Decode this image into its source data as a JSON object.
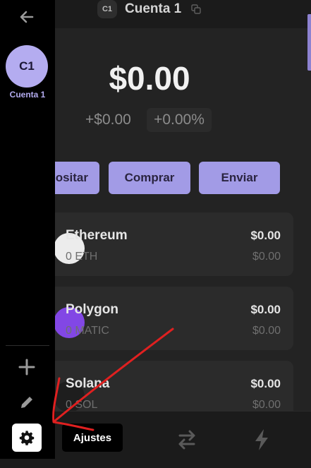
{
  "header": {
    "account_chip": "C1",
    "account_name": "Cuenta 1"
  },
  "balance": {
    "total": "$0.00",
    "change_usd": "+$0.00",
    "change_pct": "+0.00%"
  },
  "actions": {
    "deposit_label": "ositar",
    "buy_label": "Comprar",
    "send_label": "Enviar"
  },
  "tokens": [
    {
      "name": "Ethereum",
      "amount": "0 ETH",
      "value": "$0.00",
      "sub_value": "$0.00",
      "logo_icon": "ethereum-logo-icon"
    },
    {
      "name": "Polygon",
      "amount": "0 MATIC",
      "value": "$0.00",
      "sub_value": "$0.00",
      "logo_icon": "polygon-logo-icon"
    },
    {
      "name": "Solana",
      "amount": "0 SOL",
      "value": "$0.00",
      "sub_value": "$0.00",
      "logo_icon": "solana-logo-icon"
    }
  ],
  "bottom_nav": [
    "swap-icon",
    "lightning-icon"
  ],
  "sidebar": {
    "avatar_initials": "C1",
    "avatar_label": "Cuenta 1",
    "icons": [
      "back-arrow-icon",
      "plus-icon",
      "pencil-icon",
      "gear-icon"
    ],
    "tooltip": "Ajustes"
  },
  "colors": {
    "accent": "#a29be6",
    "avatar": "#b4acf0",
    "annotation": "#e02020"
  }
}
